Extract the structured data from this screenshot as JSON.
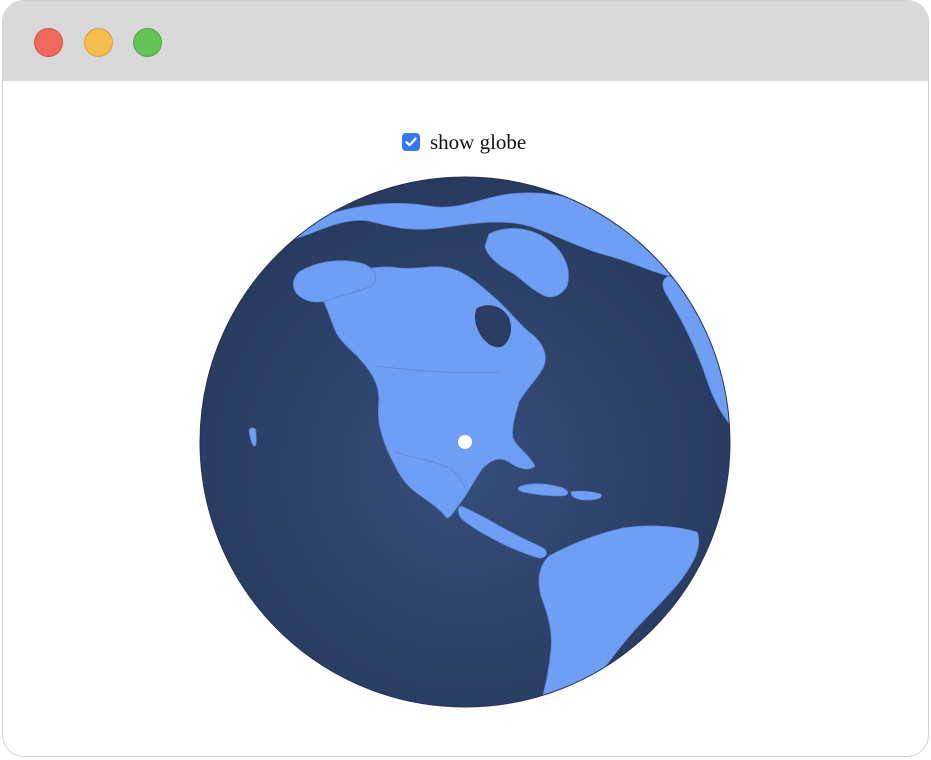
{
  "window": {
    "controls": [
      "close",
      "minimize",
      "zoom"
    ],
    "colors": {
      "close": "#ee6a5f",
      "minimize": "#f5be4f",
      "zoom": "#62c555",
      "titlebar": "#d9d9d9"
    }
  },
  "toggle": {
    "label": "show globe",
    "checked": true,
    "accent_color": "#3478f6"
  },
  "globe": {
    "ocean_color": "#2c3d63",
    "land_color": "#6f9ef5",
    "marker_color": "#ffffff",
    "icons": [
      "checkmark-icon",
      "location-marker"
    ]
  }
}
